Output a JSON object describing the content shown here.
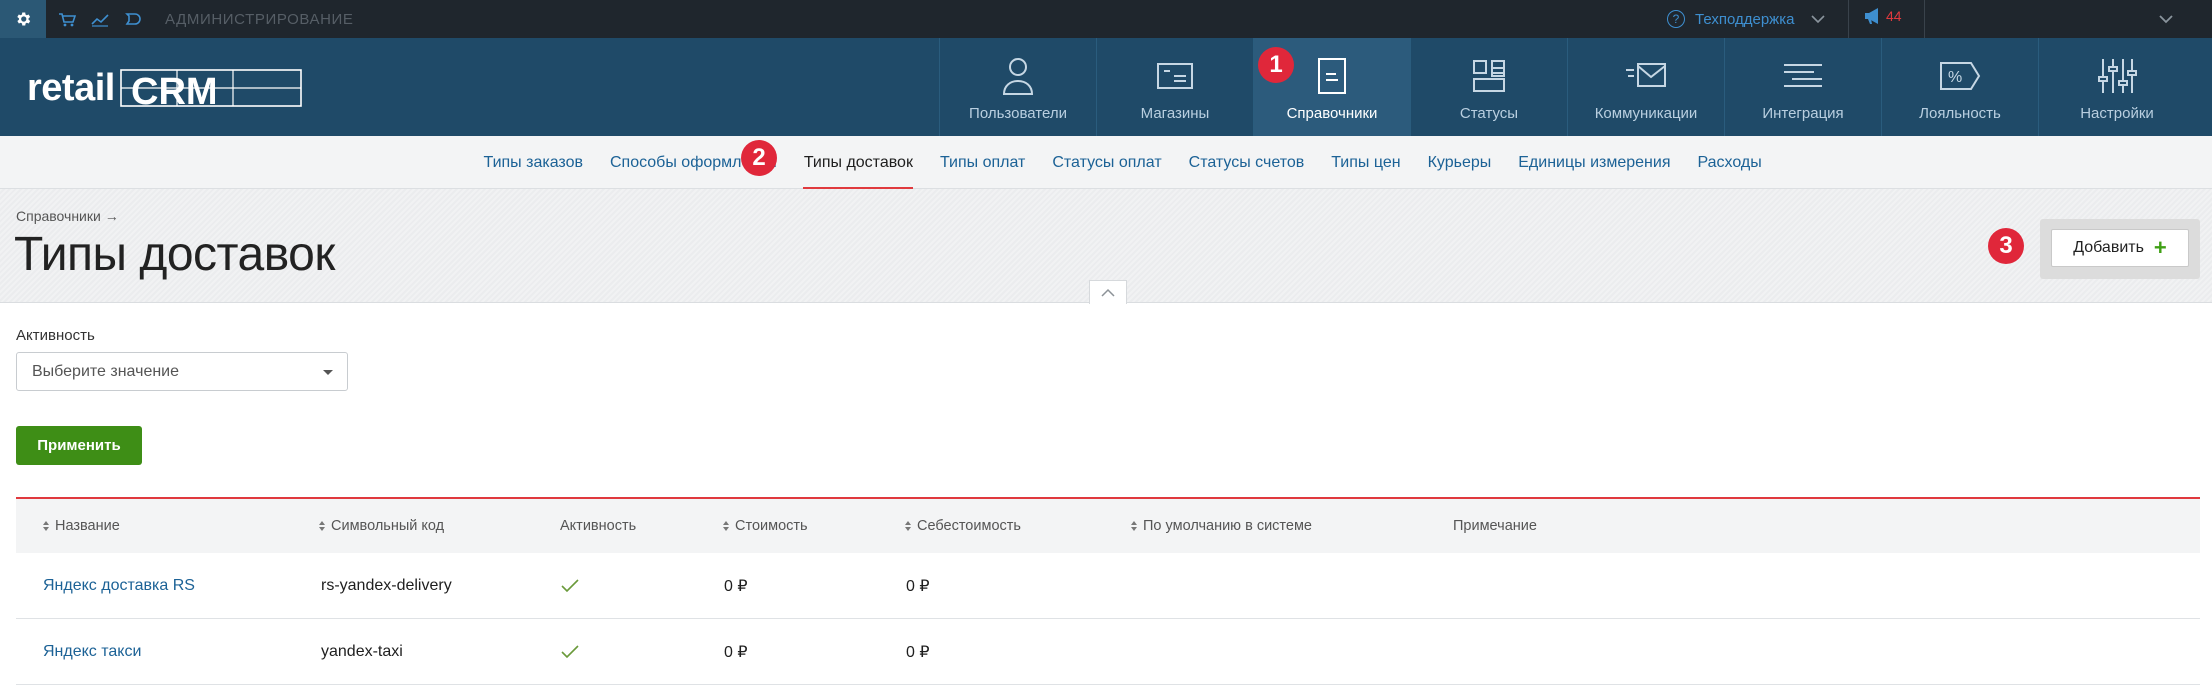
{
  "topbar": {
    "admin_label": "АДМИНИСТРИРОВАНИЕ",
    "support_label": "Техподдержка",
    "notifications_count": "44",
    "icons": [
      "gear-icon",
      "cart-icon",
      "analytics-icon",
      "chat-icon"
    ]
  },
  "header": {
    "logo_text_left": "retail",
    "logo_text_right": "CRM",
    "nav": [
      {
        "label": "Пользователи",
        "icon": "user-icon"
      },
      {
        "label": "Магазины",
        "icon": "store-icon"
      },
      {
        "label": "Справочники",
        "icon": "directory-icon",
        "active": true
      },
      {
        "label": "Статусы",
        "icon": "statuses-icon"
      },
      {
        "label": "Коммуникации",
        "icon": "communications-icon"
      },
      {
        "label": "Интеграция",
        "icon": "integration-icon"
      },
      {
        "label": "Лояльность",
        "icon": "loyalty-icon"
      },
      {
        "label": "Настройки",
        "icon": "settings-sliders-icon"
      }
    ]
  },
  "subnav": {
    "tabs": [
      {
        "label": "Типы заказов"
      },
      {
        "label": "Способы оформления"
      },
      {
        "label": "Типы доставок",
        "active": true
      },
      {
        "label": "Типы оплат"
      },
      {
        "label": "Статусы оплат"
      },
      {
        "label": "Статусы счетов"
      },
      {
        "label": "Типы цен"
      },
      {
        "label": "Курьеры"
      },
      {
        "label": "Единицы измерения"
      },
      {
        "label": "Расходы"
      }
    ]
  },
  "page": {
    "breadcrumb": "Справочники →",
    "title": "Типы доставок",
    "add_button": "Добавить",
    "add_button_plus": "+"
  },
  "filters": {
    "activity_label": "Активность",
    "activity_placeholder": "Выберите значение",
    "apply_button": "Применить"
  },
  "table": {
    "columns": [
      {
        "label": "Название",
        "sortable": true
      },
      {
        "label": "Символьный код",
        "sortable": true
      },
      {
        "label": "Активность",
        "sortable": false
      },
      {
        "label": "Стоимость",
        "sortable": true
      },
      {
        "label": "Себестоимость",
        "sortable": true
      },
      {
        "label": "По умолчанию в системе",
        "sortable": true
      },
      {
        "label": "Примечание",
        "sortable": false
      }
    ],
    "rows": [
      {
        "name": "Яндекс доставка RS",
        "code": "rs-yandex-delivery",
        "active": true,
        "cost": "0 ₽",
        "self_cost": "0 ₽",
        "default": "",
        "note": ""
      },
      {
        "name": "Яндекс такси",
        "code": "yandex-taxi",
        "active": true,
        "cost": "0 ₽",
        "self_cost": "0 ₽",
        "default": "",
        "note": ""
      }
    ]
  },
  "markers": {
    "m1": "1",
    "m2": "2",
    "m3": "3"
  },
  "colors": {
    "accent_red": "#e0393e",
    "header_bg": "#1f4a68",
    "link_blue": "#1c6296",
    "apply_green": "#3e8e16"
  }
}
